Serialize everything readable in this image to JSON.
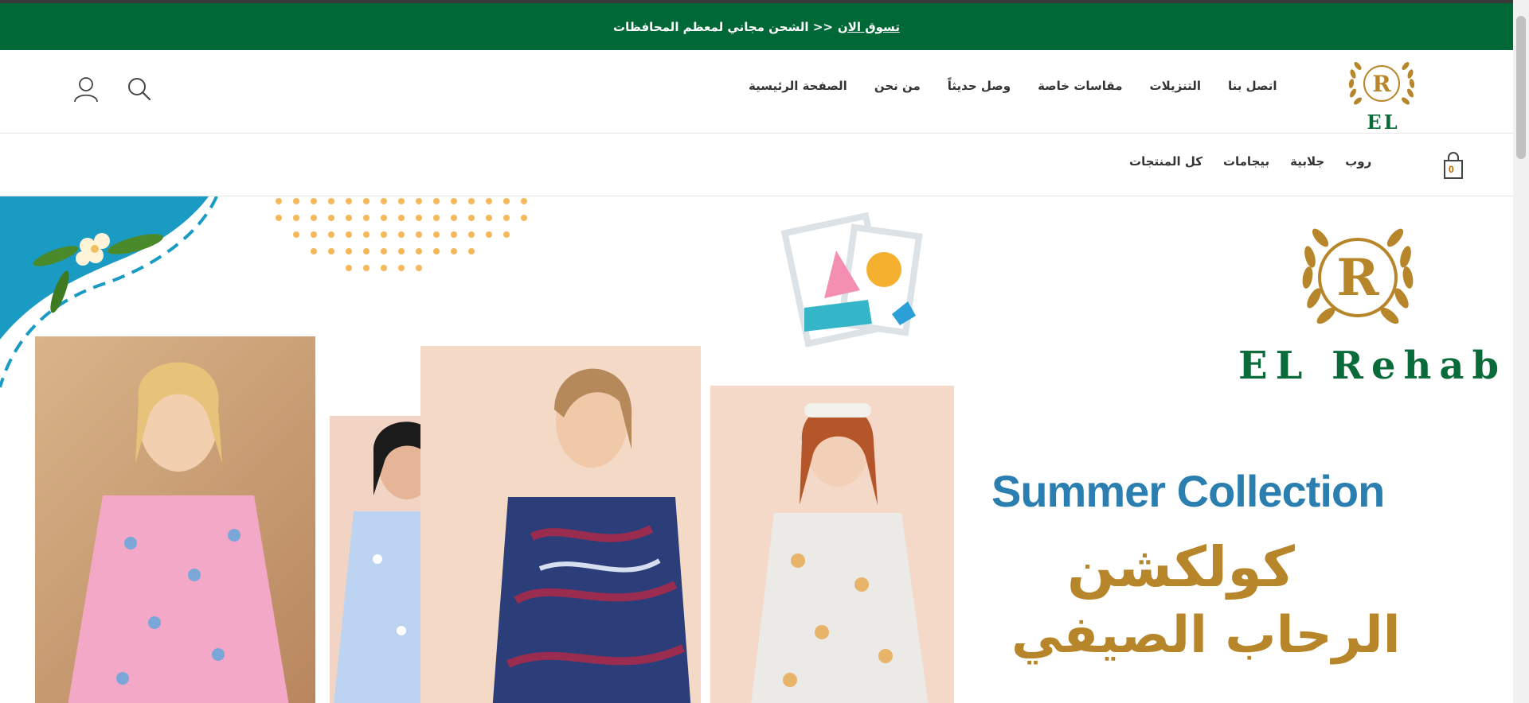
{
  "announcement": {
    "link_text": "تسوق الان",
    "text": "<< الشحن مجاني لمعظم المحافظات"
  },
  "header": {
    "brand_letter": "R",
    "brand_name": "EL Rehab",
    "nav": [
      {
        "label": "الصفحة الرئيسية"
      },
      {
        "label": "من نحن"
      },
      {
        "label": "وصل حديثاً"
      },
      {
        "label": "مقاسات خاصة"
      },
      {
        "label": "التنزيلات"
      },
      {
        "label": "اتصل بنا"
      }
    ],
    "icons": [
      "search-icon",
      "account-icon"
    ]
  },
  "subnav": {
    "categories": [
      {
        "label": "كل المنتجات"
      },
      {
        "label": "بيجامات"
      },
      {
        "label": "جلابية"
      },
      {
        "label": "روب"
      }
    ],
    "cart_count": "0"
  },
  "hero": {
    "brand_letter": "R",
    "brand_name": "EL Rehab",
    "headline": "Summer Collection",
    "arabic_line1": "كولكشن",
    "arabic_line2": "الرحاب الصيفي",
    "colors": {
      "brand_green": "#0a6b3a",
      "announce_green": "#006837",
      "gold": "#b8862a",
      "headline_blue": "#2a7fb0",
      "corner_blue": "#1a9bc4",
      "dots_orange": "#f5b85a"
    }
  }
}
